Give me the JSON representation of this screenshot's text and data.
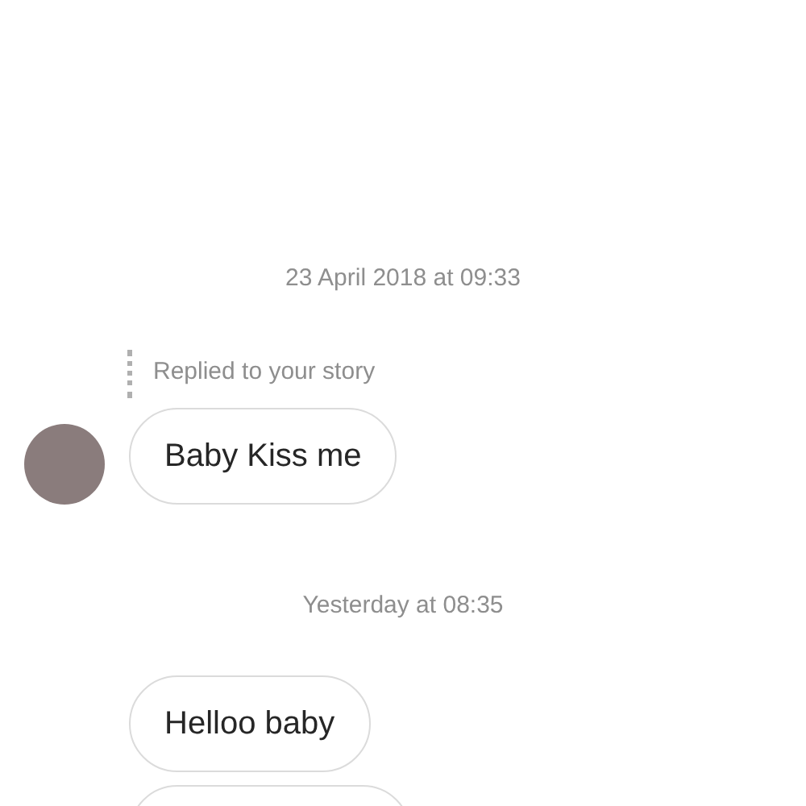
{
  "thread": [
    {
      "kind": "timestamp",
      "text": "23 April 2018 at 09:33"
    },
    {
      "kind": "reply_note",
      "text": "Replied to your story"
    },
    {
      "kind": "message",
      "text": "Baby Kiss me",
      "avatar": true
    },
    {
      "kind": "timestamp",
      "text": "Yesterday at 08:35"
    },
    {
      "kind": "message",
      "text": "Helloo baby",
      "avatar": false
    },
    {
      "kind": "cut_bubble"
    }
  ]
}
